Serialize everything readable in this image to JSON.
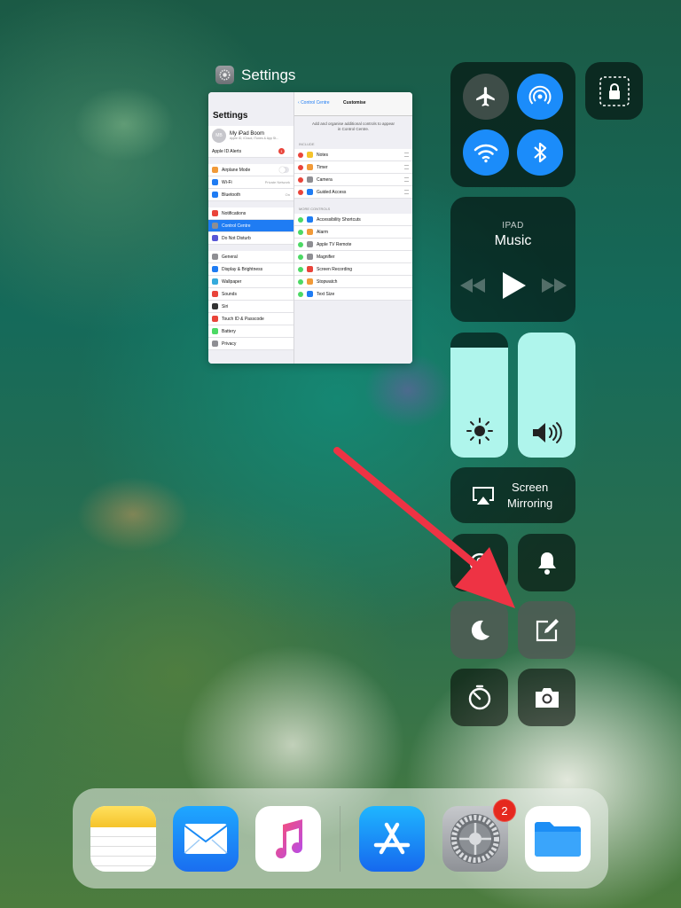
{
  "app_switcher": {
    "app_name": "Settings",
    "sidebar": {
      "title": "Settings",
      "profile_name": "My iPad Boom",
      "profile_initials": "MB",
      "profile_sub": "Apple ID, iCloud, iTunes & App St...",
      "alerts_label": "Apple ID Alerts",
      "alerts_count": "1",
      "group1": [
        {
          "label": "Airplane Mode",
          "value": "",
          "color": "#f19a38"
        },
        {
          "label": "Wi-Fi",
          "value": "Private Network",
          "color": "#1f7cf3"
        },
        {
          "label": "Bluetooth",
          "value": "On",
          "color": "#1f7cf3"
        }
      ],
      "group2": [
        {
          "label": "Notifications",
          "color": "#e9443a"
        },
        {
          "label": "Control Centre",
          "color": "#8e8e93"
        },
        {
          "label": "Do Not Disturb",
          "color": "#5856d6"
        }
      ],
      "group3": [
        {
          "label": "General",
          "color": "#8e8e93"
        },
        {
          "label": "Display & Brightness",
          "color": "#1f7cf3"
        },
        {
          "label": "Wallpaper",
          "color": "#34aadc"
        },
        {
          "label": "Sounds",
          "color": "#e9443a"
        },
        {
          "label": "Siri",
          "color": "#333333"
        },
        {
          "label": "Touch ID & Passcode",
          "color": "#e9443a"
        },
        {
          "label": "Battery",
          "color": "#4cd964"
        },
        {
          "label": "Privacy",
          "color": "#8e8e93"
        }
      ]
    },
    "detail": {
      "back_label": "Control Centre",
      "title": "Customise",
      "description": "Add and organise additional controls to appear in Control Centre.",
      "include_header": "INCLUDE",
      "include": [
        {
          "label": "Notes",
          "color": "#f5c32b"
        },
        {
          "label": "Timer",
          "color": "#f19a38"
        },
        {
          "label": "Camera",
          "color": "#8e8e93"
        },
        {
          "label": "Guided Access",
          "color": "#1f7cf3"
        }
      ],
      "more_header": "MORE CONTROLS",
      "more": [
        {
          "label": "Accessibility Shortcuts",
          "color": "#1f7cf3"
        },
        {
          "label": "Alarm",
          "color": "#f19a38"
        },
        {
          "label": "Apple TV Remote",
          "color": "#8e8e93"
        },
        {
          "label": "Magnifier",
          "color": "#8e8e93"
        },
        {
          "label": "Screen Recording",
          "color": "#e9443a"
        },
        {
          "label": "Stopwatch",
          "color": "#f19a38"
        },
        {
          "label": "Text Size",
          "color": "#1f7cf3"
        }
      ]
    }
  },
  "control_centre": {
    "music_source": "IPAD",
    "music_title": "Music",
    "brightness_level": 0.88,
    "volume_level": 1.0,
    "screen_mirroring_label_1": "Screen",
    "screen_mirroring_label_2": "Mirroring",
    "accent_color": "#1b8cfa",
    "slider_color": "#aff5ec"
  },
  "annotation": {
    "arrow_color": "#ee3344",
    "points_to": "notes-button"
  },
  "dock": {
    "apps": [
      "notes-icon",
      "mail-icon",
      "music-icon",
      "app-store-icon",
      "settings-icon",
      "files-icon"
    ],
    "settings_badge": "2"
  }
}
